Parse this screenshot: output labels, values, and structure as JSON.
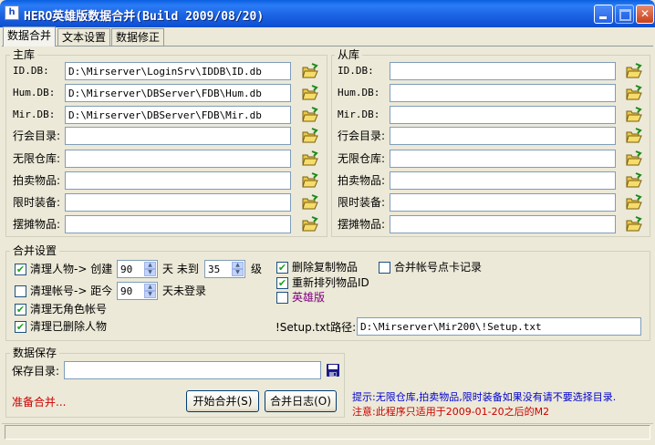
{
  "window": {
    "title": "HERO英雄版数据合并(Build 2009/08/20)",
    "app_icon_glyph": "h"
  },
  "tabs": [
    {
      "label": "数据合并",
      "active": true
    },
    {
      "label": "文本设置",
      "active": false
    },
    {
      "label": "数据修正",
      "active": false
    }
  ],
  "main_db": {
    "title": "主库",
    "rows": [
      {
        "label": "ID.DB:",
        "value": "D:\\Mirserver\\LoginSrv\\IDDB\\ID.db"
      },
      {
        "label": "Hum.DB:",
        "value": "D:\\Mirserver\\DBServer\\FDB\\Hum.db"
      },
      {
        "label": "Mir.DB:",
        "value": "D:\\Mirserver\\DBServer\\FDB\\Mir.db"
      },
      {
        "label": "行会目录:",
        "value": ""
      },
      {
        "label": "无限仓库:",
        "value": ""
      },
      {
        "label": "拍卖物品:",
        "value": ""
      },
      {
        "label": "限时装备:",
        "value": ""
      },
      {
        "label": "摆摊物品:",
        "value": ""
      }
    ]
  },
  "slave_db": {
    "title": "从库",
    "rows": [
      {
        "label": "ID.DB:",
        "value": ""
      },
      {
        "label": "Hum.DB:",
        "value": ""
      },
      {
        "label": "Mir.DB:",
        "value": ""
      },
      {
        "label": "行会目录:",
        "value": ""
      },
      {
        "label": "无限仓库:",
        "value": ""
      },
      {
        "label": "拍卖物品:",
        "value": ""
      },
      {
        "label": "限时装备:",
        "value": ""
      },
      {
        "label": "摆摊物品:",
        "value": ""
      }
    ]
  },
  "merge": {
    "title": "合并设置",
    "clean_chars": {
      "label": "清理人物-> 创建",
      "checked": true,
      "days": "90",
      "unit_days": "天 未到",
      "level": "35",
      "unit_level": "级"
    },
    "clean_accounts": {
      "label": "清理帐号-> 距今",
      "checked": false,
      "days": "90",
      "unit": "天未登录"
    },
    "clean_no_char": {
      "label": "清理无角色帐号",
      "checked": true
    },
    "clean_deleted": {
      "label": "清理已删除人物",
      "checked": true
    },
    "delete_dup": {
      "label": "删除复制物品",
      "checked": true
    },
    "renumber": {
      "label": "重新排列物品ID",
      "checked": true
    },
    "hero": {
      "label": "英雄版",
      "checked": false
    },
    "merge_card": {
      "label": "合并帐号点卡记录",
      "checked": false
    },
    "setup_label": "!Setup.txt路径:",
    "setup_value": "D:\\Mirserver\\Mir200\\!Setup.txt"
  },
  "save": {
    "title": "数据保存",
    "dir_label": "保存目录:",
    "dir_value": "",
    "status": "准备合并...",
    "start_button": "开始合并(S)",
    "log_button": "合并日志(O)"
  },
  "notes": {
    "tip": "提示:无限仓库,拍卖物品,限时装备如果没有请不要选择目录.",
    "warning": "注意:此程序只适用于2009-01-20之后的M2"
  },
  "colors": {
    "tip": "#0000cc",
    "warning": "#cc0000",
    "hero_label": "#800080",
    "status": "#cc0000"
  }
}
